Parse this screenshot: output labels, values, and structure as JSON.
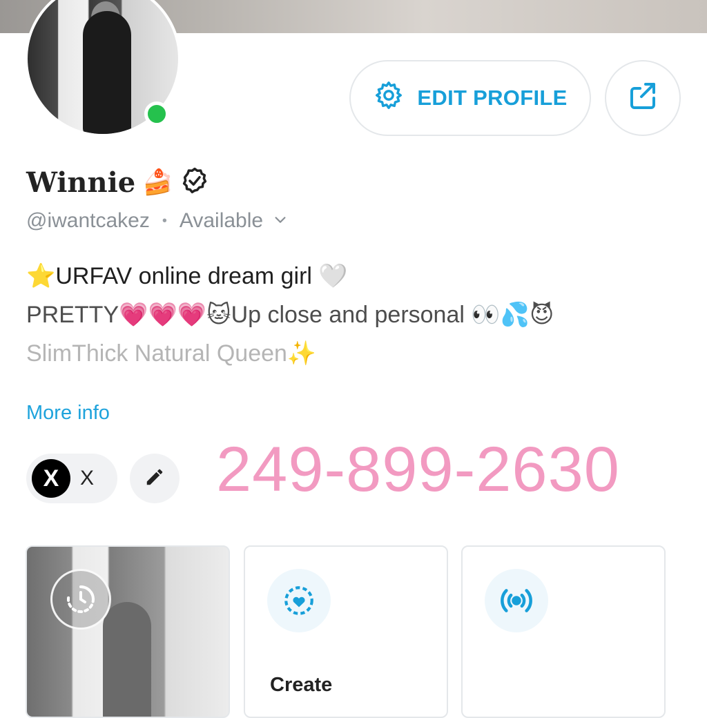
{
  "profile": {
    "name": "Winnie",
    "name_emoji": "🍰",
    "handle": "@iwantcakez",
    "separator": "•",
    "status": "Available"
  },
  "actions": {
    "edit_profile_label": "EDIT PROFILE"
  },
  "bio": {
    "line1_emoji": "⭐",
    "line1_text": "URFAV online dream girl ",
    "line1_trail": "🤍",
    "line2_text": "PRETTY",
    "line2_hearts": "💗💗💗",
    "line2_cat": "🐱",
    "line2_more": "Up close and personal ",
    "line2_trail": "👀💦😈",
    "line3_text": "SlimThick Natural Queen",
    "line3_trail": "✨"
  },
  "more_info_label": "More info",
  "social": {
    "x_icon": "X",
    "x_label": "X"
  },
  "overlay_phone": "249-899-2630",
  "cards": {
    "card2_title": "Create",
    "clock_icon": "clock-icon",
    "highlight_icon": "heart-ring-icon",
    "stream_icon": "broadcast-icon"
  },
  "colors": {
    "accent": "#179fd9",
    "online": "#25c14d",
    "phone": "#f29ac1"
  }
}
